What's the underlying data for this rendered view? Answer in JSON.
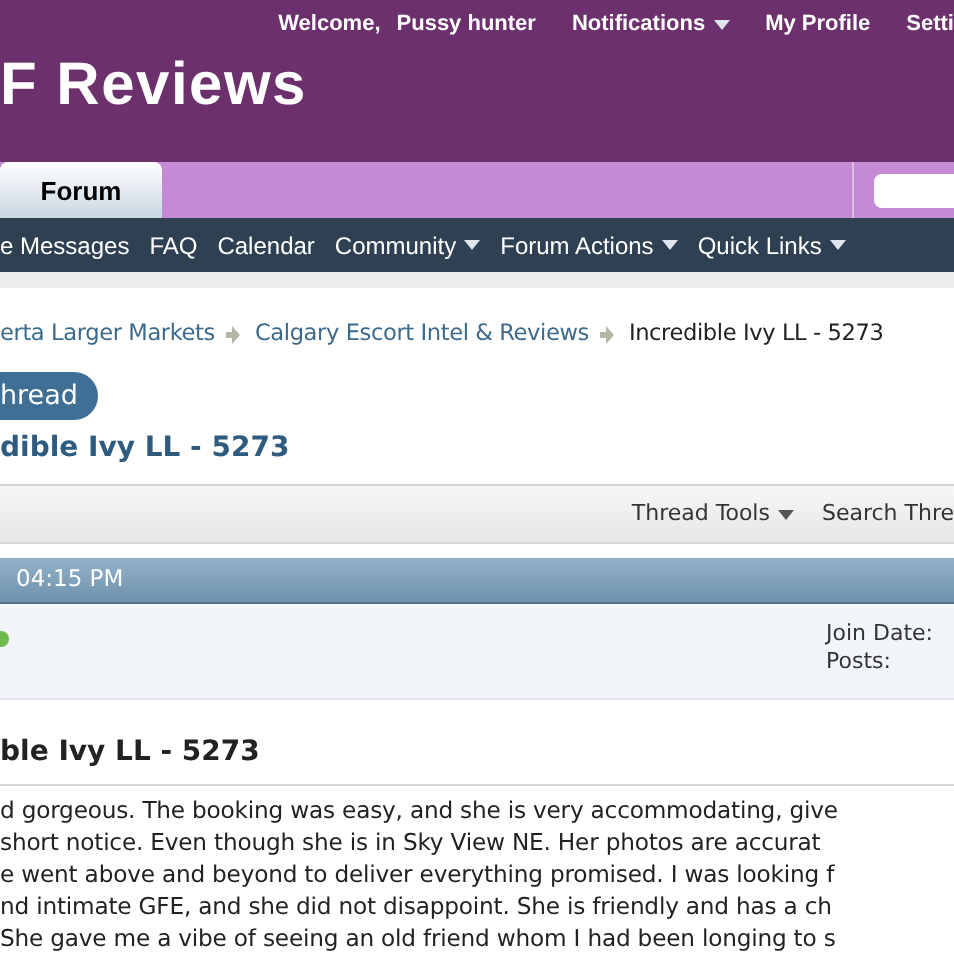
{
  "header": {
    "welcome": "Welcome,",
    "username": "Pussy hunter",
    "links": [
      {
        "label": "Notifications",
        "dropdown": true
      },
      {
        "label": "My Profile",
        "dropdown": false
      },
      {
        "label": "Setti",
        "dropdown": false
      }
    ],
    "site_title": "F Reviews"
  },
  "tabs": [
    {
      "label": "Forum",
      "selected": true
    }
  ],
  "nav": [
    {
      "label": "e Messages",
      "dropdown": false
    },
    {
      "label": "FAQ",
      "dropdown": false
    },
    {
      "label": "Calendar",
      "dropdown": false
    },
    {
      "label": "Community",
      "dropdown": true
    },
    {
      "label": "Forum Actions",
      "dropdown": true
    },
    {
      "label": "Quick Links",
      "dropdown": true
    }
  ],
  "breadcrumb": [
    {
      "label": "erta Larger Markets",
      "current": false
    },
    {
      "label": "Calgary Escort Intel & Reviews",
      "current": false
    },
    {
      "label": "Incredible Ivy LL - 5273",
      "current": true
    }
  ],
  "thread": {
    "reply_button": "hread",
    "title": "dible Ivy LL - 5273"
  },
  "toolbar": [
    {
      "label": "Thread Tools",
      "dropdown": true
    },
    {
      "label": "Search Thre",
      "dropdown": false
    }
  ],
  "post": {
    "time": "04:15 PM",
    "online": true,
    "fields": [
      "Join Date:",
      "Posts:"
    ],
    "title": "ble Ivy LL - 5273",
    "lines": [
      "d gorgeous. The booking was easy, and she is very accommodating, give",
      "short notice. Even though she is in Sky View NE. Her photos are accurat",
      "e went above and beyond to deliver everything promised. I was looking f",
      "nd intimate GFE, and she did not disappoint. She is friendly and has a ch",
      "She gave me a vibe of seeing an old friend whom I had been longing to s"
    ]
  }
}
